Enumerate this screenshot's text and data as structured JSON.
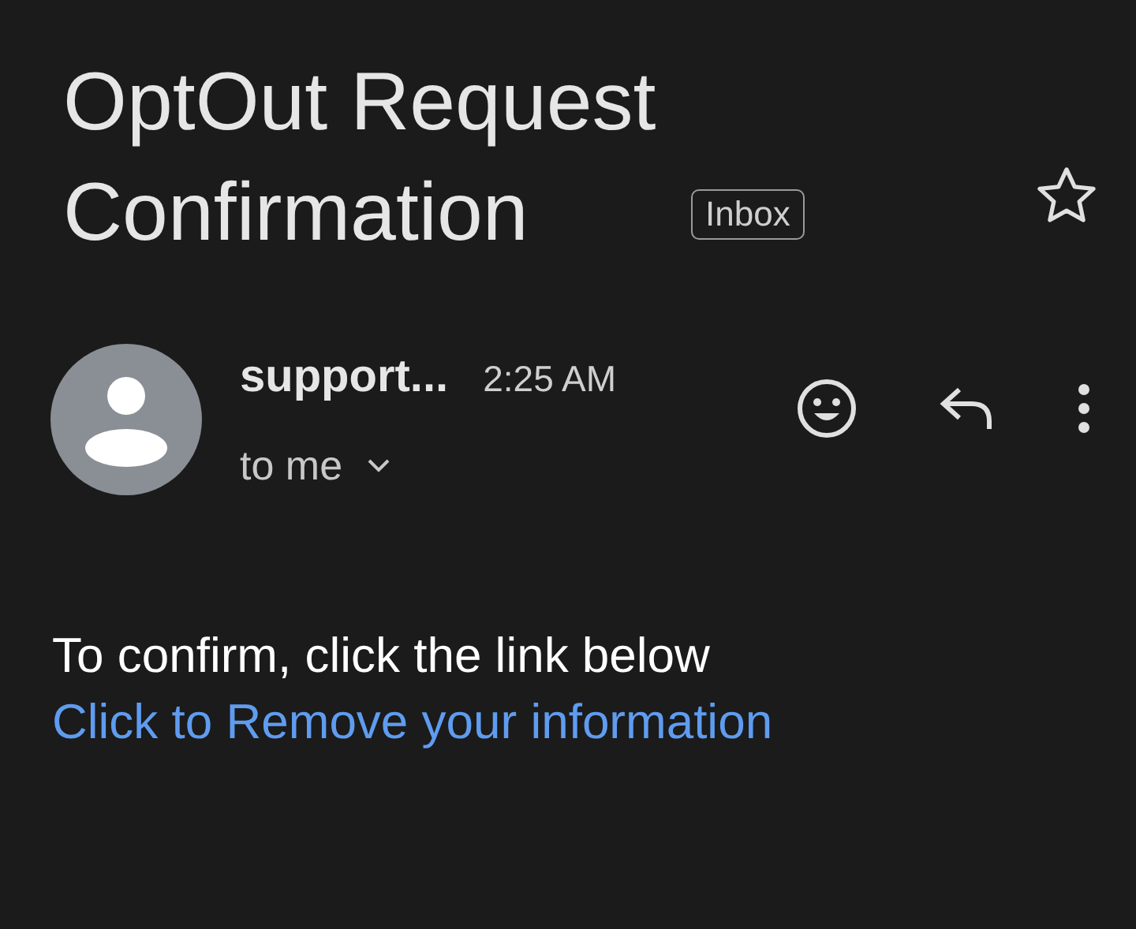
{
  "subject": "OptOut Request Confirmation",
  "label": "Inbox",
  "starred": false,
  "sender": {
    "name": "support...",
    "time": "2:25 AM",
    "recipient": "to me"
  },
  "body": {
    "text": "To confirm, click the link below",
    "link": "Click to Remove your information"
  }
}
